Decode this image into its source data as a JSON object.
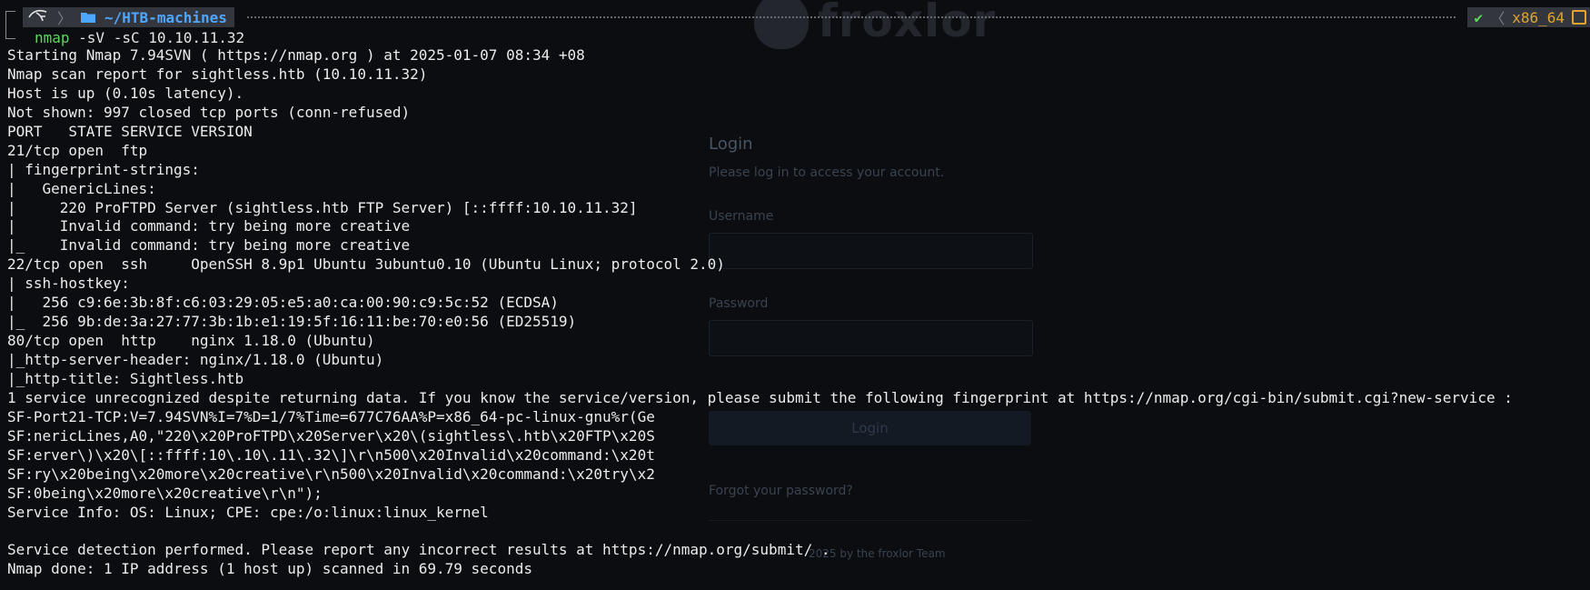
{
  "prompt": {
    "user_icon": "kali-dragon-icon",
    "folder_icon": "folder-icon",
    "cwd": "~/HTB-machines",
    "status": "✔",
    "arch": "x86_64",
    "arch_icon": "cpu-chip-icon"
  },
  "command": {
    "name": "nmap",
    "args": " -sV -sC 10.10.11.32"
  },
  "output_lines": [
    "Starting Nmap 7.94SVN ( https://nmap.org ) at 2025-01-07 08:34 +08",
    "Nmap scan report for sightless.htb (10.10.11.32)",
    "Host is up (0.10s latency).",
    "Not shown: 997 closed tcp ports (conn-refused)",
    "PORT   STATE SERVICE VERSION",
    "21/tcp open  ftp",
    "| fingerprint-strings:",
    "|   GenericLines:",
    "|     220 ProFTPD Server (sightless.htb FTP Server) [::ffff:10.10.11.32]",
    "|     Invalid command: try being more creative",
    "|_    Invalid command: try being more creative",
    "22/tcp open  ssh     OpenSSH 8.9p1 Ubuntu 3ubuntu0.10 (Ubuntu Linux; protocol 2.0)",
    "| ssh-hostkey:",
    "|   256 c9:6e:3b:8f:c6:03:29:05:e5:a0:ca:00:90:c9:5c:52 (ECDSA)",
    "|_  256 9b:de:3a:27:77:3b:1b:e1:19:5f:16:11:be:70:e0:56 (ED25519)",
    "80/tcp open  http    nginx 1.18.0 (Ubuntu)",
    "|_http-server-header: nginx/1.18.0 (Ubuntu)",
    "|_http-title: Sightless.htb",
    "1 service unrecognized despite returning data. If you know the service/version, please submit the following fingerprint at https://nmap.org/cgi-bin/submit.cgi?new-service :",
    "SF-Port21-TCP:V=7.94SVN%I=7%D=1/7%Time=677C76AA%P=x86_64-pc-linux-gnu%r(Ge",
    "SF:nericLines,A0,\"220\\x20ProFTPD\\x20Server\\x20\\(sightless\\.htb\\x20FTP\\x20S",
    "SF:erver\\)\\x20\\[::ffff:10\\.10\\.11\\.32\\]\\r\\n500\\x20Invalid\\x20command:\\x20t",
    "SF:ry\\x20being\\x20more\\x20creative\\r\\n500\\x20Invalid\\x20command:\\x20try\\x2",
    "SF:0being\\x20more\\x20creative\\r\\n\");",
    "Service Info: OS: Linux; CPE: cpe:/o:linux:linux_kernel",
    "",
    "Service detection performed. Please report any incorrect results at https://nmap.org/submit/ .",
    "Nmap done: 1 IP address (1 host up) scanned in 69.79 seconds"
  ],
  "background_page": {
    "logo_text": "froxlor",
    "title": "Login",
    "subtitle": "Please log in to access your account.",
    "username_label": "Username",
    "password_label": "Password",
    "login_button": "Login",
    "forgot_link": "Forgot your password?",
    "footer": "2025 by the froxlor Team"
  }
}
